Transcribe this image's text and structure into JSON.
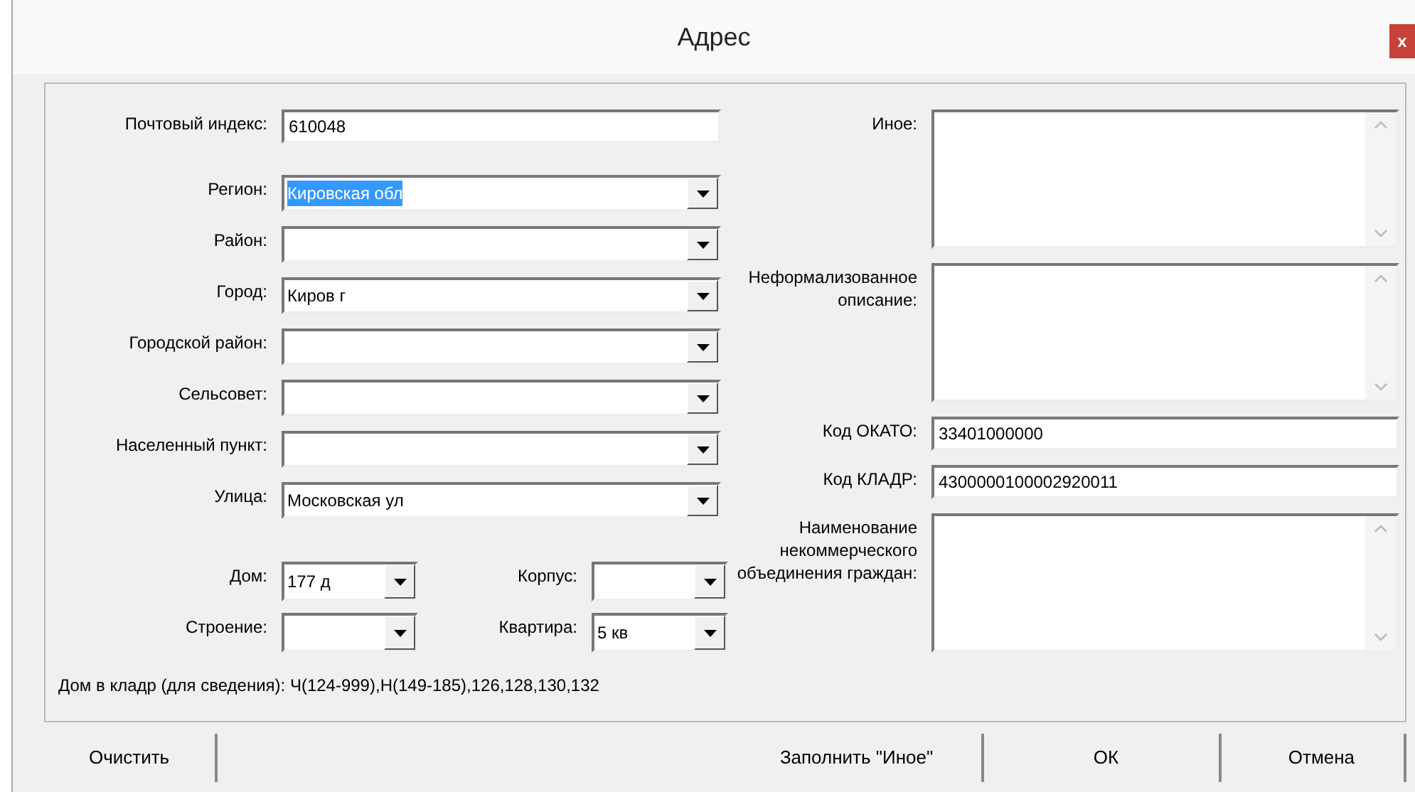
{
  "window": {
    "title": "Адрес",
    "close": "x"
  },
  "left_fields": [
    {
      "kind": "text",
      "label": "Почтовый индекс:",
      "value": "610048"
    },
    {
      "kind": "combo",
      "label": "Регион:",
      "value": "Кировская обл",
      "highlighted": true
    },
    {
      "kind": "combo",
      "label": "Район:"
    },
    {
      "kind": "combo",
      "label": "Город:",
      "value": "Киров г",
      "highlighted": false
    },
    {
      "kind": "combo",
      "label": "Городской район:"
    },
    {
      "kind": "combo",
      "label": "Сельсовет:"
    },
    {
      "kind": "combo",
      "label": "Населенный пункт:"
    },
    {
      "kind": "combo",
      "label": "Улица:",
      "value": "Московская ул",
      "highlighted": false
    }
  ],
  "house_fields": [
    {
      "label": "Дом:",
      "value": "177 д"
    },
    {
      "label": "Корпус:"
    },
    {
      "label": "Строение:"
    },
    {
      "label": "Квартира:",
      "value": "5 кв"
    }
  ],
  "kladr_note": "Дом в кладр (для сведения): Ч(124-999),Н(149-185),126,128,130,132",
  "right_fields": [
    {
      "kind": "memo",
      "label": "Иное:"
    },
    {
      "kind": "memo",
      "label": "Неформализованное описание:"
    },
    {
      "kind": "text",
      "label": "Код ОКАТО:",
      "value": "33401000000"
    },
    {
      "kind": "text",
      "label": "Код КЛАДР:",
      "value": "4300000100002920011"
    },
    {
      "kind": "memo",
      "label": "Наименование некоммерческого объединения граждан:"
    }
  ],
  "buttons": [
    {
      "label": "Очистить"
    },
    {
      "label": "Заполнить \"Иное\""
    },
    {
      "label": "ОК"
    },
    {
      "label": "Отмена"
    }
  ]
}
